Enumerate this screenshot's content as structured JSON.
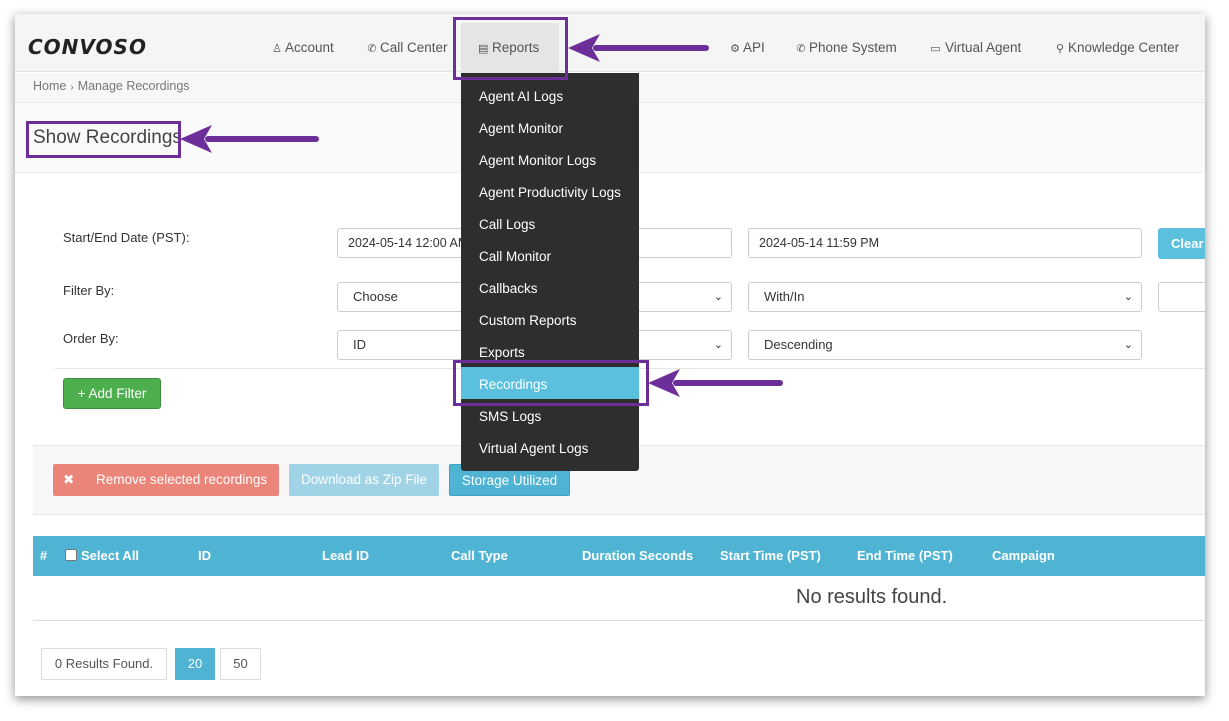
{
  "brand": {
    "logo_text": "CONVOSO"
  },
  "nav": {
    "account": "Account",
    "call_center": "Call Center",
    "reports": "Reports",
    "api": "API",
    "phone_system": "Phone System",
    "virtual_agent": "Virtual Agent",
    "knowledge_center": "Knowledge Center"
  },
  "breadcrumb": {
    "home": "Home",
    "current": "Manage Recordings"
  },
  "page": {
    "title": "Show Recordings"
  },
  "form": {
    "date_label": "Start/End Date (PST):",
    "start_date": "2024-05-14 12:00 AM",
    "end_date": "2024-05-14 11:59 PM",
    "clear_label": "Clear",
    "filter_label": "Filter By:",
    "filter_value": "Choose",
    "filter_op": "With/In",
    "order_label": "Order By:",
    "order_value": "ID",
    "order_dir": "Descending",
    "add_filter_label": "+ Add Filter"
  },
  "actions": {
    "remove": "Remove selected recordings",
    "zip": "Download as Zip File",
    "storage": "Storage Utilized"
  },
  "table": {
    "columns": [
      "#",
      "Select All",
      "ID",
      "Lead ID",
      "Call Type",
      "Duration Seconds",
      "Start Time (PST)",
      "End Time (PST)",
      "Campaign"
    ],
    "empty_message": "No results found."
  },
  "pagination": {
    "results": "0 Results Found.",
    "size_20": "20",
    "size_50": "50"
  },
  "reports_menu": {
    "items": [
      "Agent AI Logs",
      "Agent Monitor",
      "Agent Monitor Logs",
      "Agent Productivity Logs",
      "Call Logs",
      "Call Monitor",
      "Callbacks",
      "Custom Reports",
      "Exports",
      "Recordings",
      "SMS Logs",
      "Virtual Agent Logs"
    ],
    "highlighted": "Recordings"
  },
  "colors": {
    "accent": "#4fb3d3",
    "annotation": "#6c2f9a",
    "add_button": "#4cae4c",
    "remove_button": "#ec8579"
  }
}
